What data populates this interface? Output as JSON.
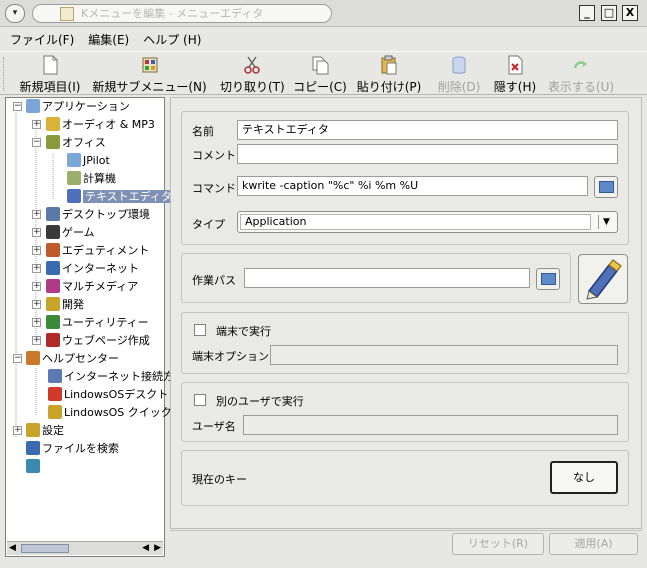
{
  "window": {
    "title": "Kメニューを編集 - メニューエディタ",
    "menu_glyph": "▾",
    "minimize": "_",
    "maximize": "□",
    "close": "X"
  },
  "menubar": {
    "items": [
      "ファイル(F)",
      "編集(E)",
      "ヘルプ (H)"
    ]
  },
  "toolbar": {
    "new_item": "新規項目(I)",
    "new_submenu": "新規サブメニュー(N)",
    "cut": "切り取り(T)",
    "copy": "コピー(C)",
    "paste": "貼り付け(P)",
    "delete": "削除(D)",
    "hide": "隠す(H)",
    "show": "表示する(U)"
  },
  "tree": {
    "items": [
      {
        "label": "アプリケーション",
        "icon": "applications-icon",
        "color": "#7aa6d8"
      },
      {
        "label": "オーディオ & MP3",
        "icon": "audio-icon",
        "color": "#d8b23a"
      },
      {
        "label": "オフィス",
        "icon": "office-icon",
        "color": "#8a9a3c"
      },
      {
        "label": "JPilot",
        "icon": "jpilot-icon",
        "color": "#7aa6d8"
      },
      {
        "label": "計算機",
        "icon": "calculator-icon",
        "color": "#9ab06a"
      },
      {
        "label": "テキストエディタ",
        "icon": "text-editor-icon",
        "color": "#4f6fb8"
      },
      {
        "label": "デスクトップ環境",
        "icon": "desktop-icon",
        "color": "#5a78a8"
      },
      {
        "label": "ゲーム",
        "icon": "games-icon",
        "color": "#3a3a3a"
      },
      {
        "label": "エデュティメント",
        "icon": "edutainment-icon",
        "color": "#c05a2a"
      },
      {
        "label": "インターネット",
        "icon": "internet-icon",
        "color": "#3a6ab0"
      },
      {
        "label": "マルチメディア",
        "icon": "multimedia-icon",
        "color": "#b03a8a"
      },
      {
        "label": "開発",
        "icon": "development-icon",
        "color": "#c8a32a"
      },
      {
        "label": "ユーティリティー",
        "icon": "utilities-icon",
        "color": "#3a8a3a"
      },
      {
        "label": "ウェブページ作成",
        "icon": "web-authoring-icon",
        "color": "#b02a2a"
      },
      {
        "label": "ヘルプセンター",
        "icon": "help-center-icon",
        "color": "#c87a2a"
      },
      {
        "label": "インターネット接続方:",
        "icon": "connect-icon",
        "color": "#5a7ab0"
      },
      {
        "label": "LindowsOSデスクト",
        "icon": "lindows-desktop-icon",
        "color": "#d03a2a"
      },
      {
        "label": "LindowsOS クイック.",
        "icon": "lindows-quick-icon",
        "color": "#c8a32a"
      },
      {
        "label": "設定",
        "icon": "settings-icon",
        "color": "#c8a32a"
      },
      {
        "label": "ファイルを検索",
        "icon": "find-files-icon",
        "color": "#3a6ab0"
      },
      {
        "label": "",
        "icon": "network-icon",
        "color": "#3a8ab0"
      }
    ]
  },
  "form": {
    "name_label": "名前",
    "name_value": "テキストエディタ",
    "comment_label": "コメント",
    "comment_value": "",
    "command_label": "コマンド",
    "command_value": "kwrite -caption \"%c\" %i %m %U",
    "type_label": "タイプ",
    "type_value": "Application",
    "workpath_label": "作業パス",
    "workpath_value": "",
    "terminal_label": "端末で実行",
    "terminal_checked": false,
    "terminal_options_label": "端末オプション",
    "terminal_options_value": "",
    "other_user_label": "別のユーザで実行",
    "other_user_checked": false,
    "username_label": "ユーザ名",
    "username_value": "",
    "hotkey_label": "現在のキー",
    "hotkey_value": "なし"
  },
  "buttons": {
    "reset": "リセット(R)",
    "apply": "適用(A)"
  },
  "colors": {
    "selection": "#7f90b5",
    "panel_bg": "#e9e9e6"
  }
}
